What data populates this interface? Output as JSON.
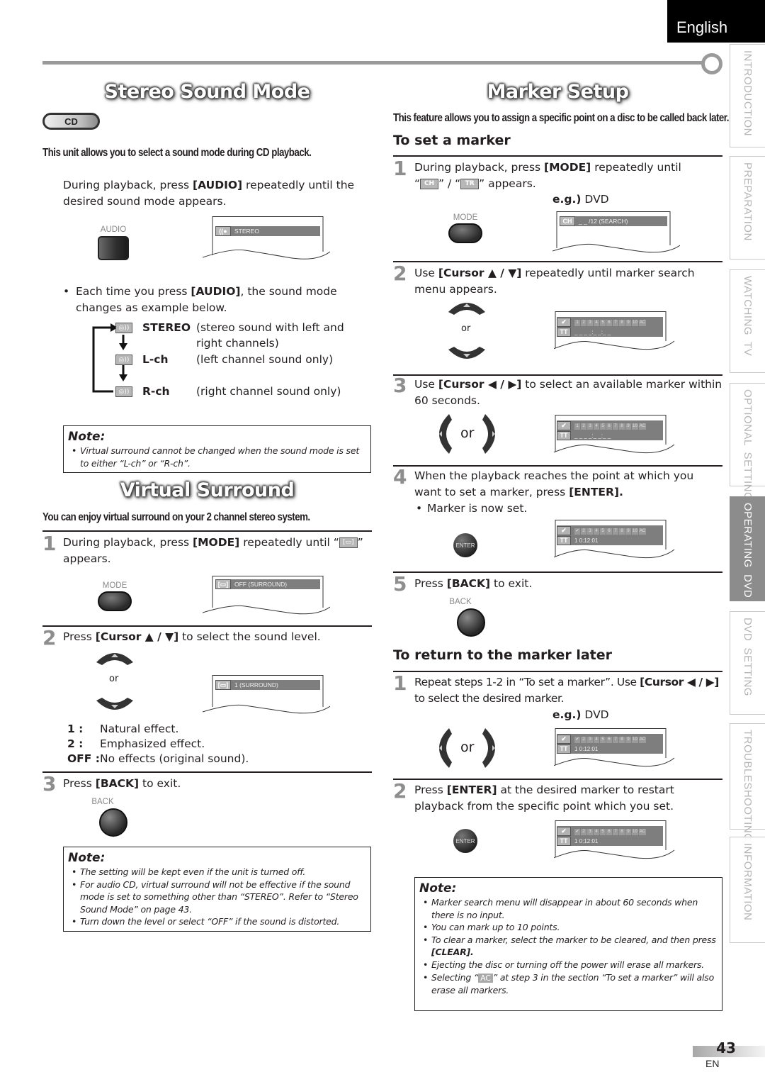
{
  "header": {
    "language_tab": "English"
  },
  "side_nav": [
    {
      "label": "INTRODUCTION",
      "active": false
    },
    {
      "label": "PREPARATION",
      "active": false
    },
    {
      "label": "WATCHING  TV",
      "active": false
    },
    {
      "label": "OPTIONAL  SETTING",
      "active": false
    },
    {
      "label": "OPERATING  DVD",
      "active": true
    },
    {
      "label": "DVD  SETTING",
      "active": false
    },
    {
      "label": "TROUBLESHOOTING",
      "active": false
    },
    {
      "label": "INFORMATION",
      "active": false
    }
  ],
  "stereo": {
    "title": "Stereo Sound Mode",
    "badge": "CD",
    "lead": "This unit allows you to select a sound mode during CD playback.",
    "instruction_pre": "During playback, press ",
    "instruction_key": "[AUDIO]",
    "instruction_post": " repeatedly until the desired sound mode appears.",
    "button_label": "AUDIO",
    "screen_text": "STEREO",
    "bullet_pre": "Each time you press ",
    "bullet_key": "[AUDIO]",
    "bullet_post": ", the sound mode changes as example below.",
    "modes": [
      {
        "name": "STEREO",
        "desc": "(stereo sound with left and right channels)"
      },
      {
        "name": "L-ch",
        "desc": "(left channel sound only)"
      },
      {
        "name": "R-ch",
        "desc": "(right channel sound only)"
      }
    ],
    "note": {
      "title": "Note:",
      "items": [
        "Virtual surround cannot be changed when the sound mode is set to either “L-ch” or “R-ch”."
      ]
    }
  },
  "surround": {
    "title": "Virtual Surround",
    "lead": "You can enjoy virtual surround on your 2 channel stereo system.",
    "steps": [
      {
        "num": "1",
        "pre": "During playback, press ",
        "key": "[MODE]",
        "post": " repeatedly until “",
        "tail": "” appears.",
        "button_label": "MODE",
        "screen_text": "OFF (SURROUND)"
      },
      {
        "num": "2",
        "pre": "Press ",
        "key": "[Cursor ▲ / ▼]",
        "post": " to select the sound level.",
        "or": "or",
        "screen_text": "1 (SURROUND)"
      },
      {
        "num": "3",
        "pre": "Press ",
        "key": "[BACK]",
        "post": " to exit.",
        "button_label": "BACK"
      }
    ],
    "levels": [
      {
        "key": "1 :",
        "desc": "Natural effect."
      },
      {
        "key": "2 :",
        "desc": "Emphasized effect."
      },
      {
        "key": "OFF :",
        "desc": "No effects (original sound)."
      }
    ],
    "note": {
      "title": "Note:",
      "items": [
        "The setting will be kept even if the unit is turned off.",
        "For audio CD, virtual surround will not be effective if the sound mode is set to something other than “STEREO”. Refer to “Stereo Sound Mode” on page 43.",
        "Turn down the level or select “OFF” if the sound is distorted."
      ]
    }
  },
  "marker": {
    "title": "Marker Setup",
    "lead": "This feature allows you to assign a specific point on a disc to be called back later.",
    "set_title": "To set a marker",
    "eg_label": "e.g.)",
    "eg_value": "DVD",
    "icons": {
      "ch": "CH",
      "tr": "TR",
      "tt": "TT",
      "ac": "AC"
    },
    "marker_slots": [
      "1",
      "2",
      "3",
      "4",
      "5",
      "6",
      "7",
      "8",
      "9",
      "10",
      "AC"
    ],
    "set_steps": [
      {
        "num": "1",
        "pre": "During playback, press ",
        "key": "[MODE]",
        "post": " repeatedly until",
        "line2_a": "“",
        "line2_b": "” / “",
        "line2_c": "” appears.",
        "button_label": "MODE",
        "screen_text": "_ _ /12   (SEARCH)"
      },
      {
        "num": "2",
        "pre": "Use ",
        "key": "[Cursor ▲ / ▼]",
        "post": " repeatedly until marker search menu appears.",
        "or": "or",
        "screen_time": "_ _  _ _:_ _:_ _"
      },
      {
        "num": "3",
        "pre": "Use ",
        "key": "[Cursor ◀ / ▶]",
        "post": " to select an available marker within 60 seconds.",
        "or": "or",
        "screen_time": "_ _  _ _:_ _:_ _"
      },
      {
        "num": "4",
        "pre": "When the playback reaches the point at which you want to set a marker, press ",
        "key": "[ENTER].",
        "post": "",
        "bullet": "Marker is now set.",
        "button_label": "ENTER",
        "screen_time": "1  0:12:01"
      },
      {
        "num": "5",
        "pre": "Press ",
        "key": "[BACK]",
        "post": " to exit.",
        "button_label": "BACK"
      }
    ],
    "return_title": "To return to the marker later",
    "return_steps": [
      {
        "num": "1",
        "pre": "Repeat steps 1-2 in “To set a marker”. Use ",
        "key": "[Cursor ◀ / ▶]",
        "post": " to select the desired marker.",
        "or": "or",
        "screen_time": "1  0:12:01"
      },
      {
        "num": "2",
        "pre": "Press ",
        "key": "[ENTER]",
        "post": " at the desired marker to restart playback from the specific point which you set.",
        "button_label": "ENTER",
        "screen_time": "1  0:12:01"
      }
    ],
    "note": {
      "title": "Note:",
      "items": [
        "Marker search menu will disappear in about 60 seconds when there is no input.",
        "You can mark up to 10 points.",
        "To clear a marker, select the marker to be cleared, and then press ",
        "Ejecting the disc or turning off the power will erase all markers.",
        "Selecting “",
        "” at step 3 in the section “To set a marker” will also erase all markers."
      ],
      "clear_key": "[CLEAR]."
    }
  },
  "footer": {
    "page_number": "43",
    "lang_code": "EN"
  }
}
